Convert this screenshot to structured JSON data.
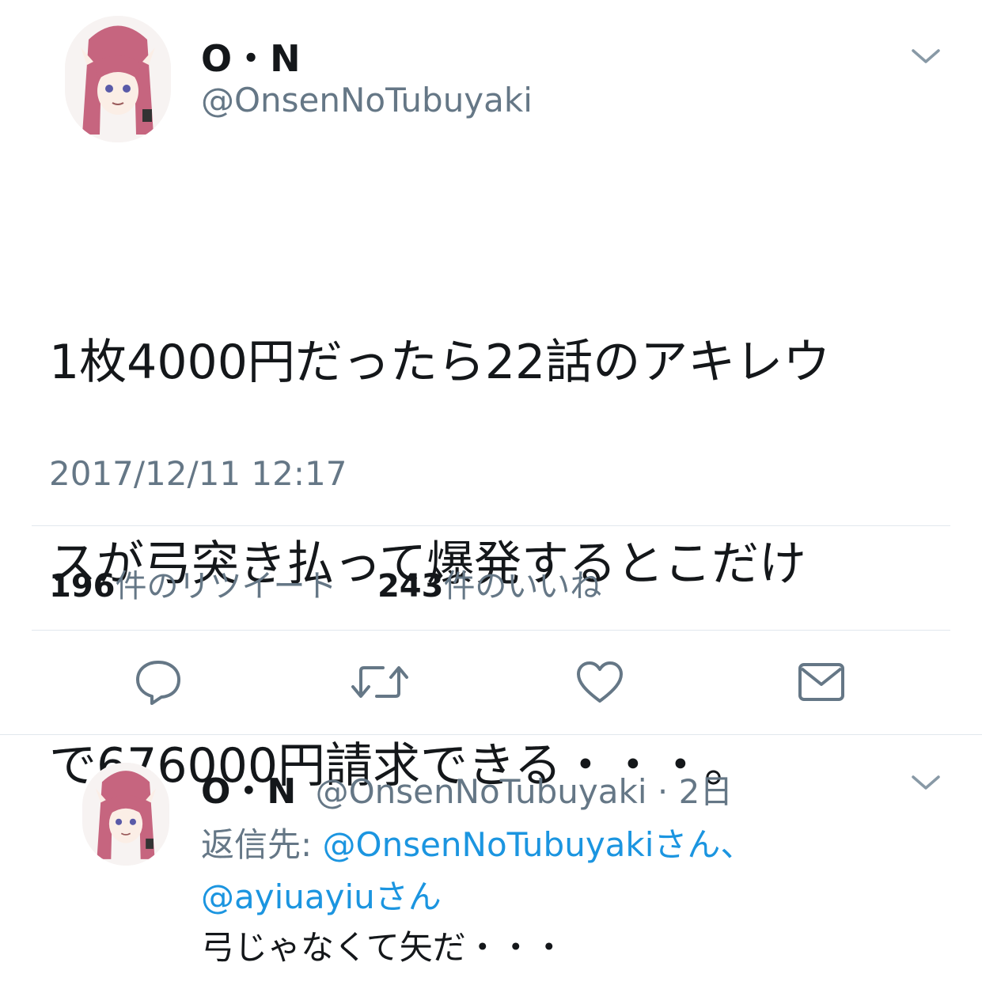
{
  "tweet": {
    "author_name": "O・N",
    "author_handle": "@OnsenNoTubuyaki",
    "text_lines": [
      "1枚4000円だったら22話のアキレウ",
      "スが弓突き払って爆発するとこだけ",
      "で676000円請求できる・・・。"
    ],
    "timestamp": "2017/12/11 12:17",
    "retweet_count": "196",
    "retweet_label": "件のリツイート",
    "like_count": "243",
    "like_label": "件のいいね",
    "actions": [
      "reply-icon",
      "retweet-icon",
      "like-icon",
      "direct-message-icon"
    ]
  },
  "reply": {
    "author_name": "O・N",
    "author_handle": "@OnsenNoTubuyaki",
    "separator": "·",
    "time_ago": "2日",
    "reply_to_prefix": "返信先: ",
    "reply_to_user1": "@OnsenNoTubuyaki",
    "reply_to_suffix1": "さん、",
    "reply_to_user2": "@ayiuayiu",
    "reply_to_suffix2": "さん",
    "text": "弓じゃなくて矢だ・・・"
  },
  "colors": {
    "text": "#14171a",
    "secondary": "#657786",
    "link": "#1b95e0",
    "divider": "#e1e8ed",
    "icon": "#657786"
  }
}
